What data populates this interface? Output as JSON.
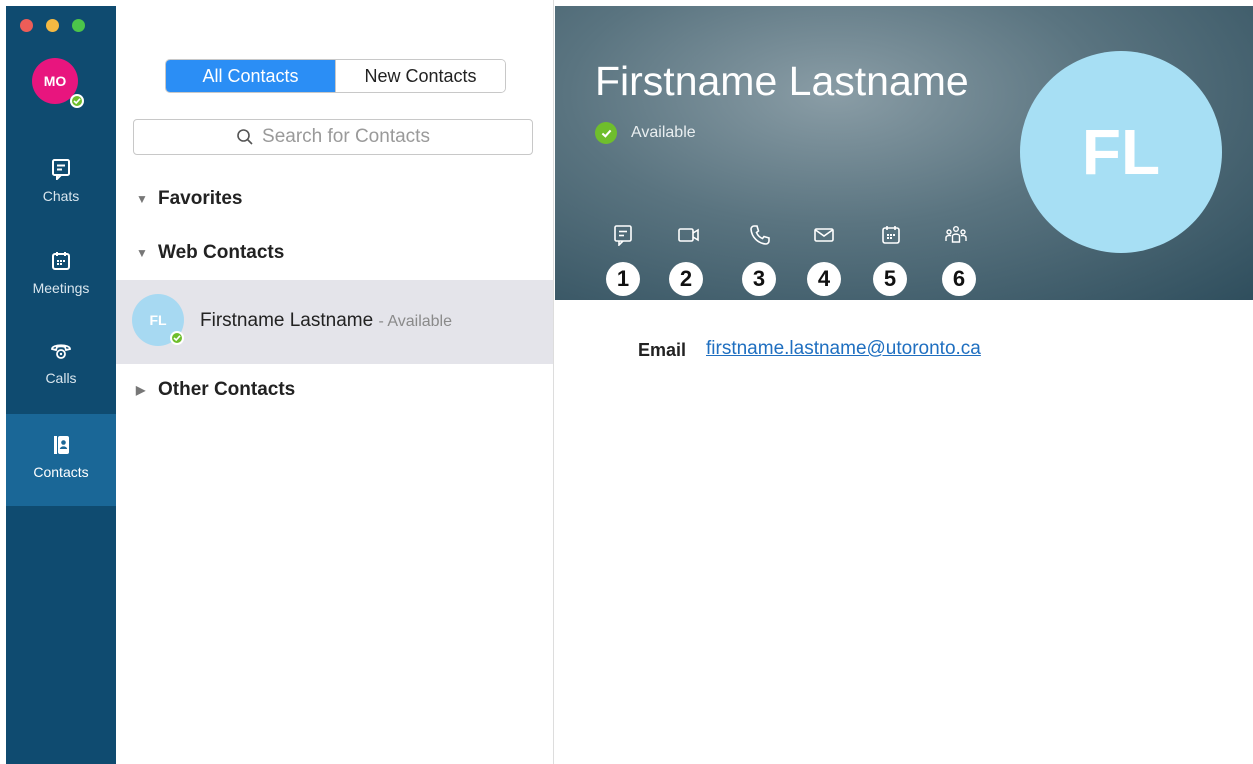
{
  "window": {
    "controls": [
      "close",
      "minimize",
      "zoom"
    ]
  },
  "profile": {
    "initials": "MO",
    "avatar_color": "#e8157e",
    "presence_color": "#6fbe2c"
  },
  "nav": {
    "items": [
      {
        "label": "Chats",
        "icon": "chat-icon"
      },
      {
        "label": "Meetings",
        "icon": "calendar-icon"
      },
      {
        "label": "Calls",
        "icon": "phone-icon"
      },
      {
        "label": "Contacts",
        "icon": "contacts-icon",
        "selected": true
      }
    ],
    "rail_color": "#0f4b70",
    "selected_color": "#1a6797"
  },
  "contacts": {
    "tabs": [
      {
        "label": "All Contacts",
        "active": true
      },
      {
        "label": "New Contacts",
        "active": false
      }
    ],
    "search": {
      "placeholder": "Search for Contacts",
      "icon": "search-icon"
    },
    "groups": [
      {
        "label": "Favorites",
        "expanded": true
      },
      {
        "label": "Web Contacts",
        "expanded": true
      },
      {
        "label": "Other Contacts",
        "expanded": false
      }
    ],
    "selected_contact": {
      "initials": "FL",
      "name": "Firstname Lastname",
      "status": "- Available"
    }
  },
  "detail": {
    "name": "Firstname Lastname",
    "status": "Available",
    "initials": "FL",
    "actions": [
      {
        "icon": "chat-icon",
        "badge": "1"
      },
      {
        "icon": "video-icon",
        "badge": "2"
      },
      {
        "icon": "phone-icon",
        "badge": "3"
      },
      {
        "icon": "mail-icon",
        "badge": "4"
      },
      {
        "icon": "calendar-icon",
        "badge": "5"
      },
      {
        "icon": "people-icon",
        "badge": "6"
      }
    ],
    "email": {
      "label": "Email",
      "value": "firstname.lastname@utoronto.ca"
    }
  }
}
